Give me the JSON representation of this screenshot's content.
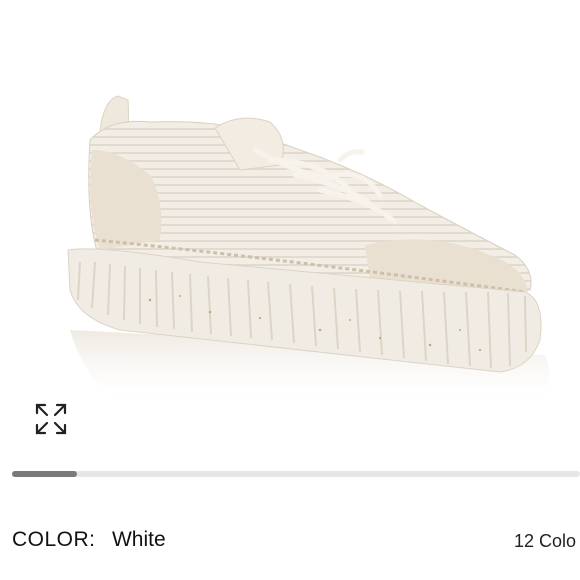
{
  "product": {
    "image_alt": "White platform sneaker",
    "color_label": "COLOR:",
    "color_value": "White",
    "color_count_text": "12 Colo"
  },
  "carousel": {
    "progress": 0.115
  },
  "icons": {
    "expand": "expand-arrows-icon"
  },
  "colors": {
    "shoe_body": "#f4efe6",
    "sole": "#f1ece3",
    "suede": "#e9e0d2",
    "track": "#e6e6e6",
    "thumb": "#7a7a7a"
  }
}
